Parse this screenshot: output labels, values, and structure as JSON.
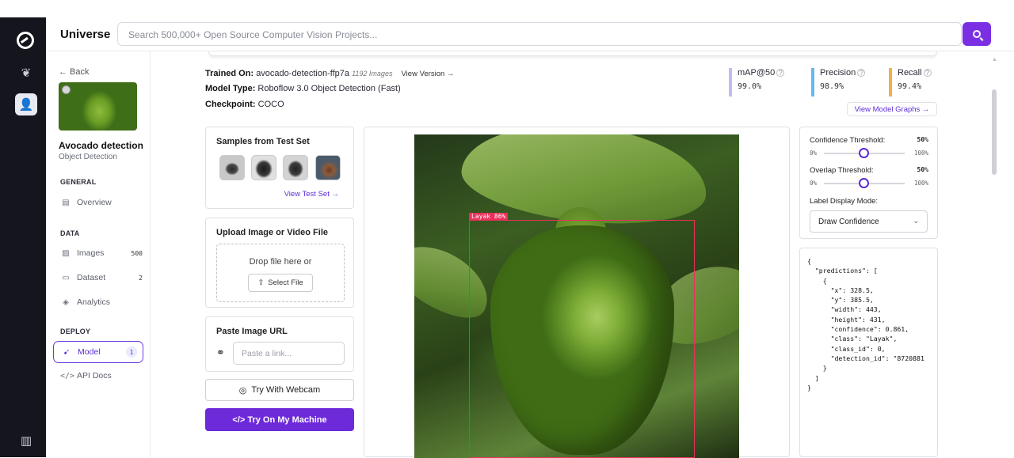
{
  "topbar": {
    "brand": "Universe",
    "search_placeholder": "Search 500,000+ Open Source Computer Vision Projects..."
  },
  "sidebar": {
    "back": "← Back",
    "project_title": "Avocado detection",
    "project_type": "Object Detection",
    "sections": {
      "general": "GENERAL",
      "data": "DATA",
      "deploy": "DEPLOY"
    },
    "items": [
      {
        "label": "Overview",
        "icon": "document-icon",
        "count": ""
      },
      {
        "label": "Images",
        "icon": "image-icon",
        "count": "500"
      },
      {
        "label": "Dataset",
        "icon": "dataset-icon",
        "count": "2"
      },
      {
        "label": "Analytics",
        "icon": "analytics-icon",
        "count": ""
      },
      {
        "label": "Model",
        "icon": "rocket-icon",
        "count": "1"
      },
      {
        "label": "API Docs",
        "icon": "code-icon",
        "count": ""
      }
    ]
  },
  "header": {
    "trained_on_label": "Trained On:",
    "trained_on_value": "avocado-detection-ffp7a",
    "images_count": "1192 Images",
    "view_version": "View Version →",
    "model_type_label": "Model Type:",
    "model_type_value": "Roboflow 3.0 Object Detection (Fast)",
    "checkpoint_label": "Checkpoint:",
    "checkpoint_value": "COCO"
  },
  "metrics": [
    {
      "label": "mAP@50",
      "value": "99.0%",
      "color": "#c9b8ef"
    },
    {
      "label": "Precision",
      "value": "98.9%",
      "color": "#66b8ee"
    },
    {
      "label": "Recall",
      "value": "99.4%",
      "color": "#f3b04a"
    }
  ],
  "view_graphs": "View Model Graphs →",
  "samples": {
    "title": "Samples from Test Set",
    "link": "View Test Set →"
  },
  "upload": {
    "title": "Upload Image or Video File",
    "drop": "Drop file here or",
    "button": "Select File"
  },
  "paste": {
    "title": "Paste Image URL",
    "placeholder": "Paste a link..."
  },
  "webcam_button": "Try With Webcam",
  "machine_button": "</> Try On My Machine",
  "detection": {
    "label": "Layak 86%"
  },
  "controls": {
    "confidence_label": "Confidence Threshold:",
    "confidence_value": "50%",
    "confidence_fraction": 0.5,
    "overlap_label": "Overlap Threshold:",
    "overlap_value": "50%",
    "overlap_fraction": 0.5,
    "slider_min": "0%",
    "slider_max": "100%",
    "label_mode_label": "Label Display Mode:",
    "label_mode_value": "Draw Confidence"
  },
  "json_output": "{\n  \"predictions\": [\n    {\n      \"x\": 328.5,\n      \"y\": 385.5,\n      \"width\": 443,\n      \"height\": 431,\n      \"confidence\": 0.861,\n      \"class\": \"Layak\",\n      \"class_id\": 0,\n      \"detection_id\": \"8720881\n    }\n  ]\n}"
}
